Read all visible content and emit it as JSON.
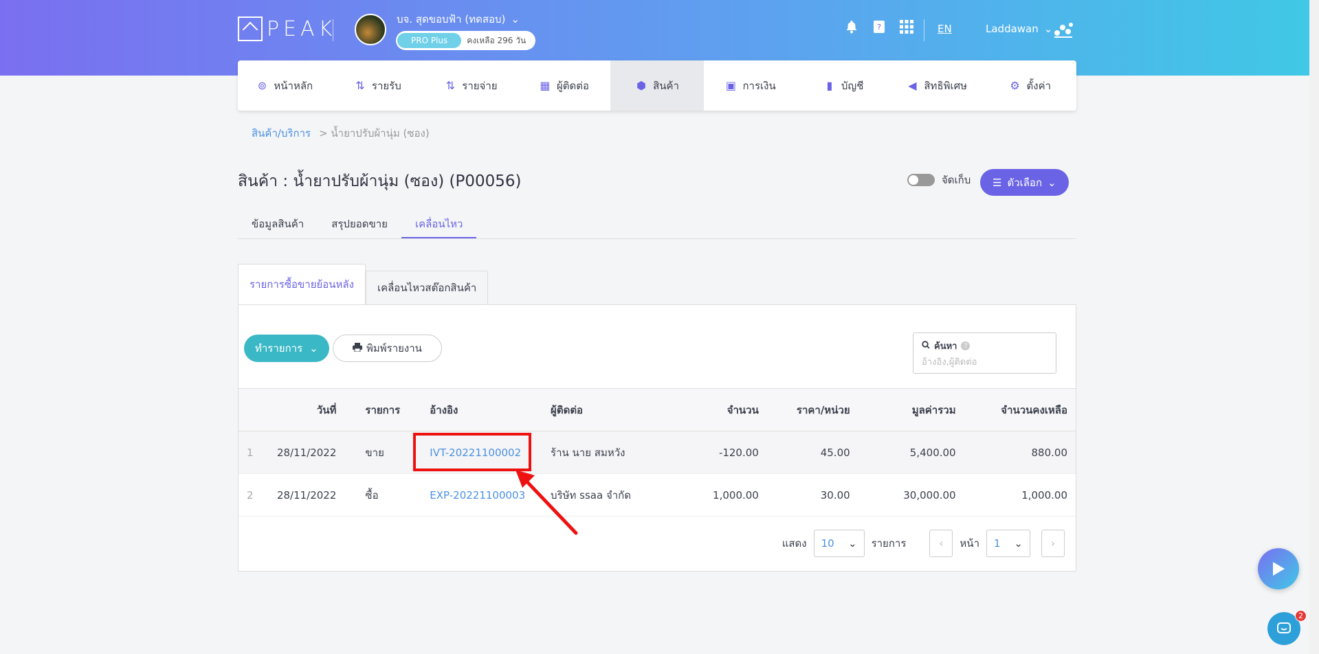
{
  "header": {
    "logo_text": "PEAK",
    "company_name": "บจ. สุดขอบฟ้า (ทดสอบ)",
    "plan": "PRO Plus",
    "days_left": "คงเหลือ 296 วัน",
    "lang": "EN",
    "user": "Laddawan"
  },
  "nav": [
    {
      "label": "หน้าหลัก",
      "icon": "dashboard-icon",
      "glyph": "⊚"
    },
    {
      "label": "รายรับ",
      "icon": "income-icon",
      "glyph": "⇅"
    },
    {
      "label": "รายจ่าย",
      "icon": "expense-icon",
      "glyph": "⇅"
    },
    {
      "label": "ผู้ติดต่อ",
      "icon": "contact-icon",
      "glyph": "▦"
    },
    {
      "label": "สินค้า",
      "icon": "product-box-icon",
      "glyph": "⬢",
      "active": true
    },
    {
      "label": "การเงิน",
      "icon": "money-icon",
      "glyph": "▣"
    },
    {
      "label": "บัญชี",
      "icon": "ledger-icon",
      "glyph": "▮"
    },
    {
      "label": "สิทธิพิเศษ",
      "icon": "megaphone-icon",
      "glyph": "◀"
    },
    {
      "label": "ตั้งค่า",
      "icon": "gear-icon",
      "glyph": "⚙"
    }
  ],
  "breadcrumb": {
    "link": "สินค้า/บริการ",
    "current": "> น้ำยาปรับผ้านุ่ม (ซอง)"
  },
  "page_title": "สินค้า : น้ำยาปรับผ้านุ่ม (ซอง) (P00056)",
  "archive_label": "จัดเก็บ",
  "options_label": "ตัวเลือก",
  "subtabs": [
    "ข้อมูลสินค้า",
    "สรุปยอดขาย",
    "เคลื่อนไหว"
  ],
  "innertabs": [
    "รายการซื้อขายย้อนหลัง",
    "เคลื่อนไหวสต๊อกสินค้า"
  ],
  "actions": {
    "create": "ทำรายการ",
    "print": "พิมพ์รายงาน"
  },
  "search": {
    "label": "ค้นหา",
    "placeholder": "อ้างอิง,ผู้ติดต่อ"
  },
  "table": {
    "headers": [
      "",
      "วันที่",
      "รายการ",
      "อ้างอิง",
      "ผู้ติดต่อ",
      "จำนวน",
      "ราคา/หน่วย",
      "มูลค่ารวม",
      "จำนวนคงเหลือ"
    ],
    "rows": [
      {
        "idx": "1",
        "date": "28/11/2022",
        "type": "ขาย",
        "ref": "IVT-20221100002",
        "contact": "ร้าน นาย สมหวัง",
        "qty": "-120.00",
        "price": "45.00",
        "total": "5,400.00",
        "balance": "880.00"
      },
      {
        "idx": "2",
        "date": "28/11/2022",
        "type": "ซื้อ",
        "ref": "EXP-20221100003",
        "contact": "บริษัท ssaa จำกัด",
        "qty": "1,000.00",
        "price": "30.00",
        "total": "30,000.00",
        "balance": "1,000.00"
      }
    ]
  },
  "pager": {
    "show": "แสดง",
    "page_size": "10",
    "items": "รายการ",
    "page": "หน้า",
    "page_num": "1"
  },
  "chat_badge": "2",
  "colors": {
    "accent": "#6a63e6",
    "teal": "#3bb8c6",
    "link": "#4a90e2",
    "highlight": "#ee1111"
  }
}
